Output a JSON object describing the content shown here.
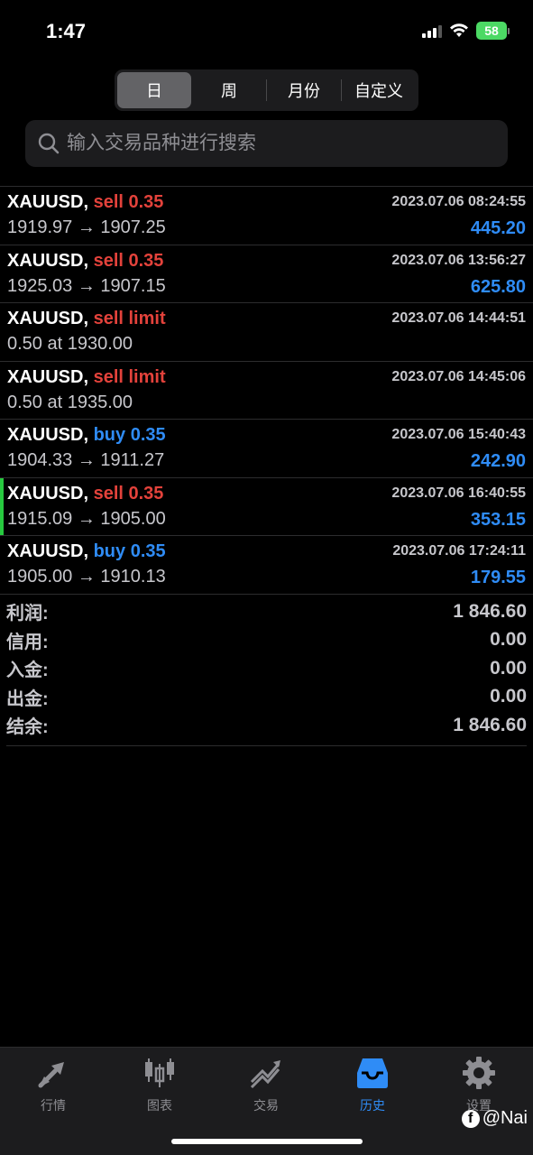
{
  "status": {
    "time": "1:47",
    "battery": "58"
  },
  "segments": [
    {
      "label": "日",
      "active": true
    },
    {
      "label": "周",
      "active": false
    },
    {
      "label": "月份",
      "active": false
    },
    {
      "label": "自定义",
      "active": false
    }
  ],
  "search": {
    "placeholder": "输入交易品种进行搜索"
  },
  "orders": [
    {
      "symbol": "XAUUSD,",
      "side": "sell",
      "detail": "sell 0.35",
      "time": "2023.07.06 08:24:55",
      "prices": "1919.97 → 1907.25",
      "profit": "445.20",
      "marked": false
    },
    {
      "symbol": "XAUUSD,",
      "side": "sell",
      "detail": "sell 0.35",
      "time": "2023.07.06 13:56:27",
      "prices": "1925.03 → 1907.15",
      "profit": "625.80",
      "marked": false
    },
    {
      "symbol": "XAUUSD,",
      "side": "sell",
      "detail": "sell limit",
      "time": "2023.07.06 14:44:51",
      "prices": "0.50 at 1930.00",
      "profit": "",
      "marked": false
    },
    {
      "symbol": "XAUUSD,",
      "side": "sell",
      "detail": "sell limit",
      "time": "2023.07.06 14:45:06",
      "prices": "0.50 at 1935.00",
      "profit": "",
      "marked": false
    },
    {
      "symbol": "XAUUSD,",
      "side": "buy",
      "detail": "buy 0.35",
      "time": "2023.07.06 15:40:43",
      "prices": "1904.33 → 1911.27",
      "profit": "242.90",
      "marked": false
    },
    {
      "symbol": "XAUUSD,",
      "side": "sell",
      "detail": "sell 0.35",
      "time": "2023.07.06 16:40:55",
      "prices": "1915.09 → 1905.00",
      "profit": "353.15",
      "marked": true
    },
    {
      "symbol": "XAUUSD,",
      "side": "buy",
      "detail": "buy 0.35",
      "time": "2023.07.06 17:24:11",
      "prices": "1905.00 → 1910.13",
      "profit": "179.55",
      "marked": false
    }
  ],
  "summary": [
    {
      "label": "利润:",
      "value": "1 846.60"
    },
    {
      "label": "信用:",
      "value": "0.00"
    },
    {
      "label": "入金:",
      "value": "0.00"
    },
    {
      "label": "出金:",
      "value": "0.00"
    },
    {
      "label": "结余:",
      "value": "1 846.60"
    }
  ],
  "tabs": [
    {
      "label": "行情",
      "icon": "quotes-arrows-icon",
      "active": false
    },
    {
      "label": "图表",
      "icon": "candlestick-chart-icon",
      "active": false
    },
    {
      "label": "交易",
      "icon": "trade-trend-icon",
      "active": false
    },
    {
      "label": "历史",
      "icon": "history-inbox-icon",
      "active": true
    },
    {
      "label": "设置",
      "icon": "gear-icon",
      "active": false
    }
  ],
  "watermark": {
    "text": "@Nai",
    "icon": "facebook-icon"
  },
  "colors": {
    "sell": "#e3423b",
    "buy": "#2f8cf6",
    "profit": "#2f8cf6",
    "active_tab": "#2f8cf6",
    "marker": "#27c93f"
  }
}
